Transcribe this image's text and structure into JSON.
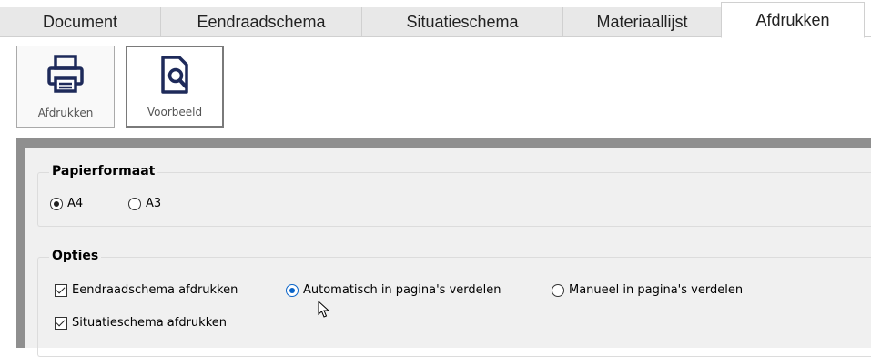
{
  "tabs": [
    {
      "label": "Document",
      "active": false
    },
    {
      "label": "Eendraadschema",
      "active": false
    },
    {
      "label": "Situatieschema",
      "active": false
    },
    {
      "label": "Materiaallijst",
      "active": false
    },
    {
      "label": "Afdrukken",
      "active": true
    }
  ],
  "toolbar": {
    "print_label": "Afdrukken",
    "print_icon": "printer-icon",
    "preview_label": "Voorbeeld",
    "preview_icon": "document-search-icon"
  },
  "paper_format": {
    "title": "Papierformaat",
    "options": [
      {
        "label": "A4",
        "selected": true
      },
      {
        "label": "A3",
        "selected": false
      }
    ]
  },
  "options": {
    "title": "Opties",
    "print_eendraadschema_label": "Eendraadschema afdrukken",
    "print_eendraadschema_checked": true,
    "auto_pages_label": "Automatisch in pagina's verdelen",
    "auto_pages_selected": true,
    "manual_pages_label": "Manueel in pagina's verdelen",
    "manual_pages_selected": false,
    "print_situatieschema_label": "Situatieschema afdrukken",
    "print_situatieschema_checked": true
  },
  "colors": {
    "accent": "#0a64c8",
    "panel_border": "#8f8f8f",
    "tab_inactive": "#e8e8e8"
  }
}
